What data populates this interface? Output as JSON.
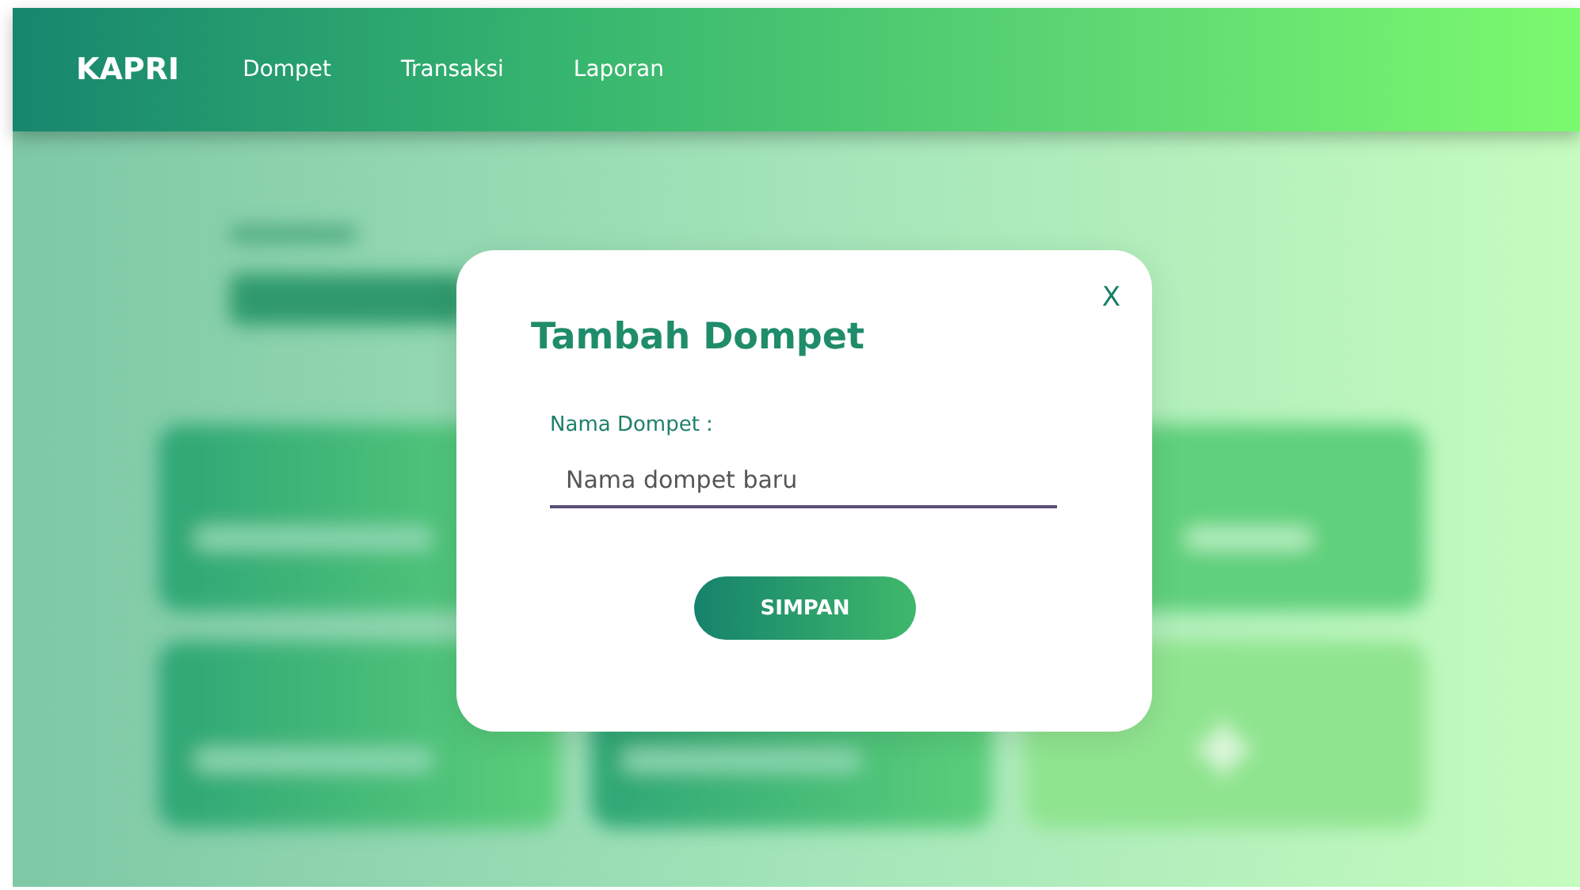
{
  "navbar": {
    "brand": "KAPRI",
    "links": [
      {
        "label": "Dompet"
      },
      {
        "label": "Transaksi"
      },
      {
        "label": "Laporan"
      }
    ]
  },
  "dialog": {
    "close": "X",
    "title": "Tambah Dompet",
    "field_label": "Nama Dompet :",
    "field_placeholder": "Nama dompet baru",
    "button": "SIMPAN"
  }
}
